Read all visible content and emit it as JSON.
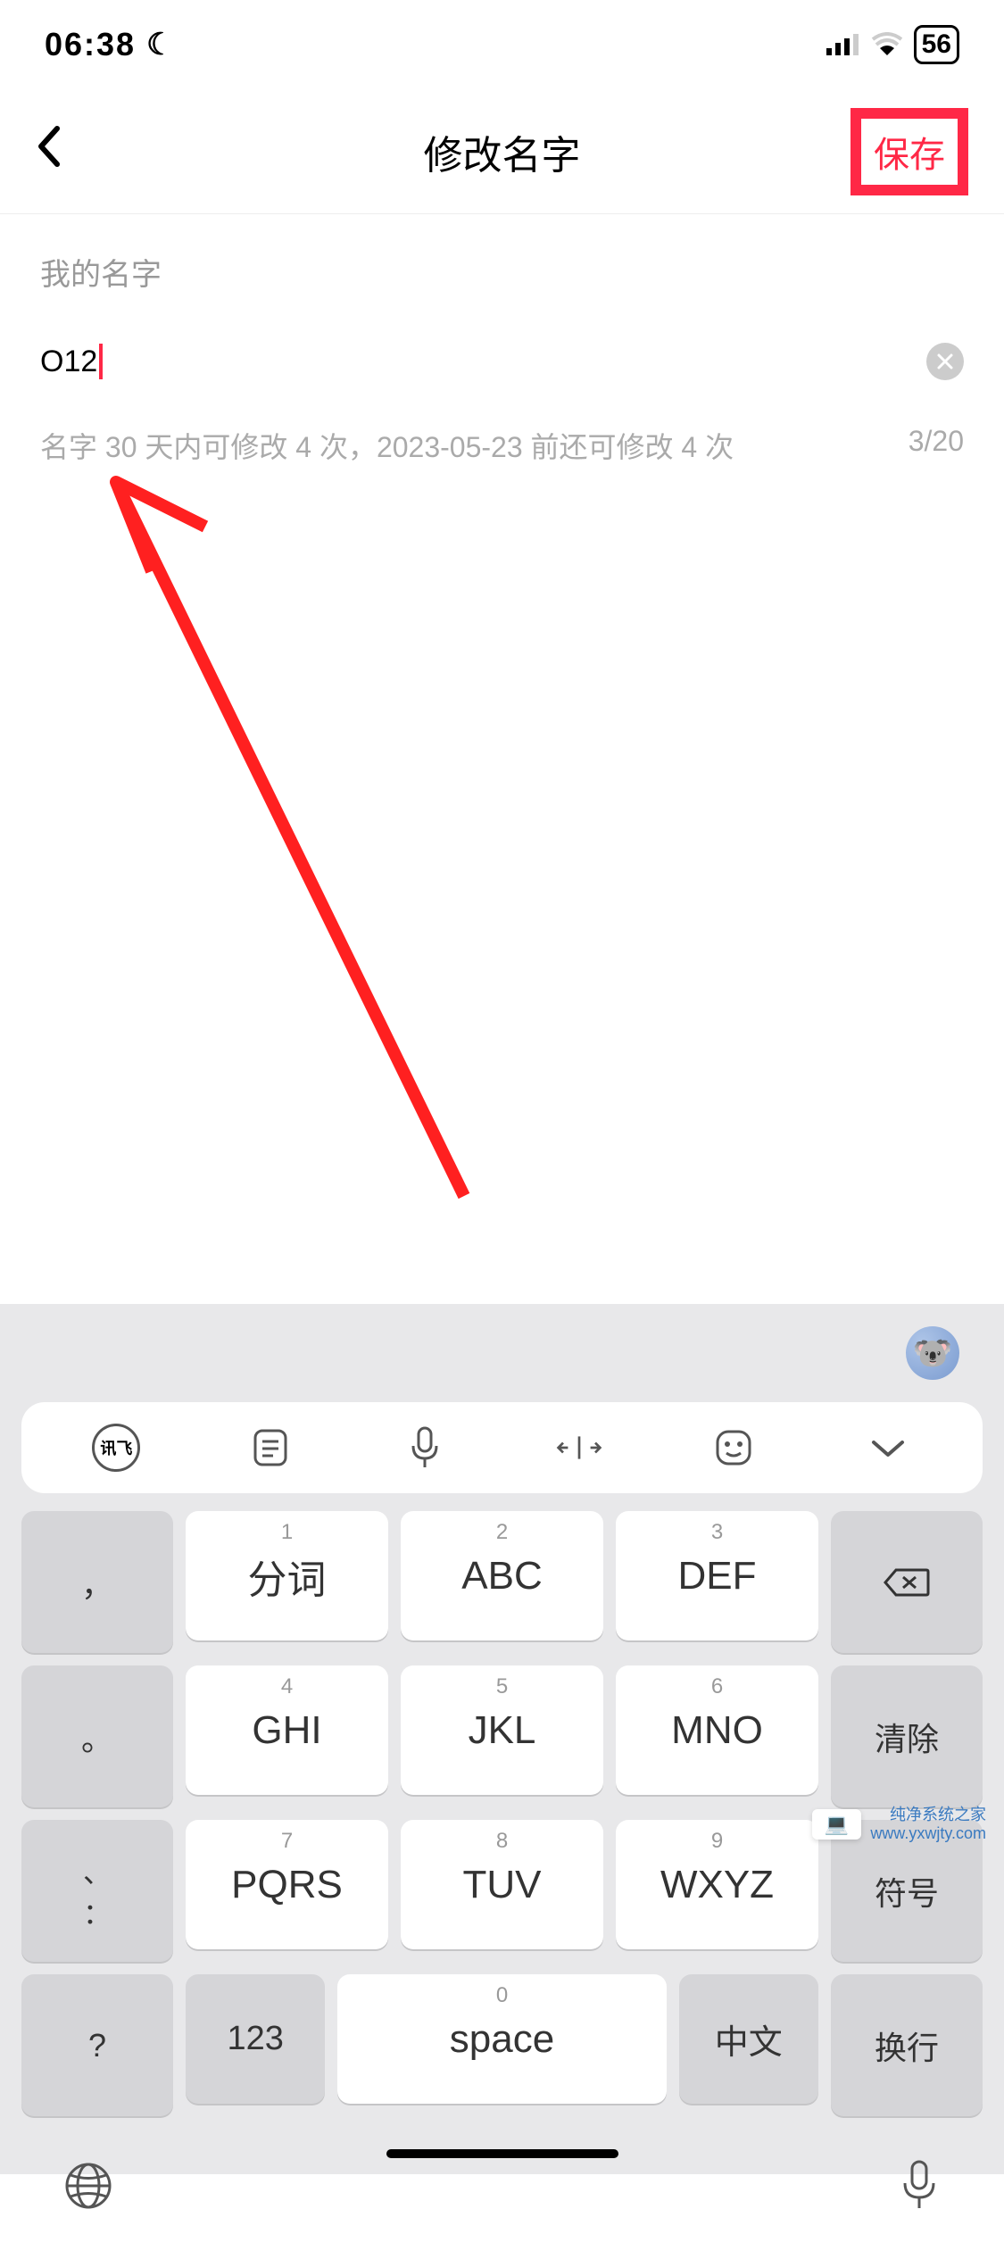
{
  "status": {
    "time": "06:38",
    "battery": "56"
  },
  "nav": {
    "title": "修改名字",
    "save": "保存"
  },
  "section": {
    "label": "我的名字"
  },
  "input": {
    "value": "O12"
  },
  "info": {
    "hint": "名字 30 天内可修改 4 次，2023-05-23 前还可修改 4 次",
    "count": "3/20"
  },
  "toolbar": {
    "ifly": "讯飞"
  },
  "keys": {
    "r1": {
      "k1_num": "1",
      "k1": "分词",
      "k2_num": "2",
      "k2": "ABC",
      "k3_num": "3",
      "k3": "DEF"
    },
    "r2": {
      "k1_num": "4",
      "k1": "GHI",
      "k2_num": "5",
      "k2": "JKL",
      "k3_num": "6",
      "k3": "MNO"
    },
    "r3": {
      "k1_num": "7",
      "k1": "PQRS",
      "k2_num": "8",
      "k2": "TUV",
      "k3_num": "9",
      "k3": "WXYZ"
    },
    "r4": {
      "k1": "123",
      "k2_num": "0",
      "k2": "space",
      "k3": "中文"
    },
    "side_left": {
      "k1": "，",
      "k2": "。",
      "k3": "、",
      "k3b": "：",
      "k4": "?"
    },
    "side_right": {
      "k1": "⌫",
      "k2": "清除",
      "k3": "符号",
      "k4": "换行"
    }
  },
  "watermark": {
    "brand": "纯净系统之家",
    "url": "www.yxwjty.com"
  }
}
